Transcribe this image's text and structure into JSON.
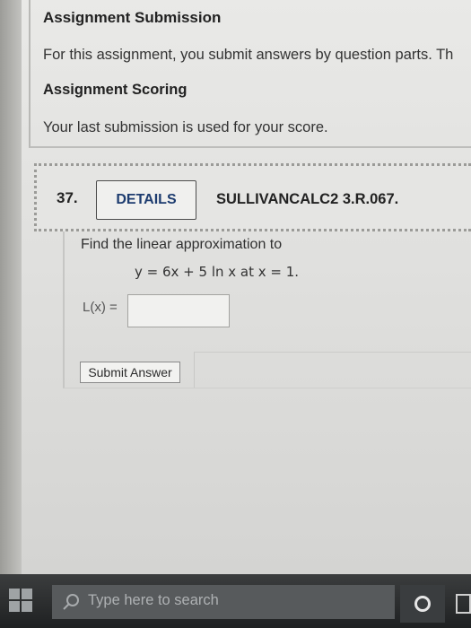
{
  "info": {
    "submission_heading": "Assignment Submission",
    "submission_text": "For this assignment, you submit answers by question parts. Th",
    "scoring_heading": "Assignment Scoring",
    "scoring_text": "Your last submission is used for your score."
  },
  "question": {
    "number": "37.",
    "details_label": "DETAILS",
    "code": "SULLIVANCALC2 3.R.067.",
    "prompt": "Find the linear approximation to",
    "equation": "y = 6x + 5 ln x at x = 1.",
    "answer_label": "L(x) =",
    "answer_value": "",
    "submit_label": "Submit Answer"
  },
  "taskbar": {
    "search_placeholder": "Type here to search",
    "start_icon": "windows-logo",
    "search_icon": "search-icon",
    "cortana_icon": "cortana-circle",
    "task_view_icon": "task-view"
  }
}
